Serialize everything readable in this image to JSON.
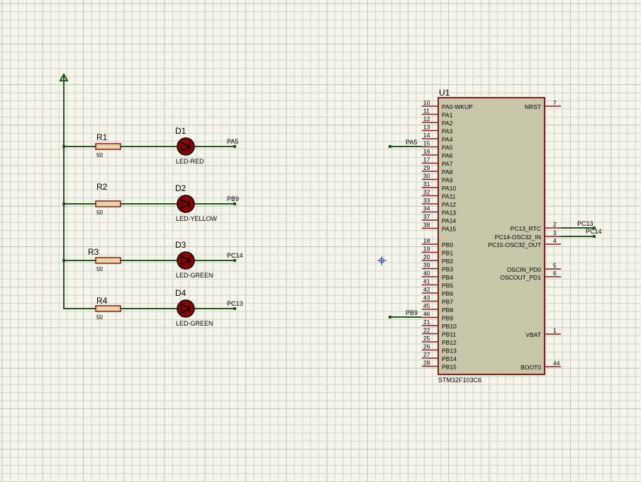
{
  "colors": {
    "background": "#f5f5eb",
    "grid_minor": "#d3d3c7",
    "grid_major": "#c2c2b3",
    "wire": "#1f5a1f",
    "component_outline": "#8b1a1a",
    "chip_fill": "#c6c6a8",
    "led_fill": "#8b0000",
    "resistor_fill": "#e8d6a8",
    "text": "#000000",
    "cursor": "#1f3fbf"
  },
  "power": {
    "symbol": "power-arrow-icon"
  },
  "resistors": [
    {
      "ref": "R1",
      "value": "50"
    },
    {
      "ref": "R2",
      "value": "50"
    },
    {
      "ref": "R3",
      "value": "50"
    },
    {
      "ref": "R4",
      "value": "50"
    }
  ],
  "leds": [
    {
      "ref": "D1",
      "type": "LED-RED",
      "net": "PA5"
    },
    {
      "ref": "D2",
      "type": "LED-YELLOW",
      "net": "PB9"
    },
    {
      "ref": "D3",
      "type": "LED-GREEN",
      "net": "PC14"
    },
    {
      "ref": "D4",
      "type": "LED-GREEN",
      "net": "PC13"
    }
  ],
  "chip": {
    "ref": "U1",
    "part": "STM32F103C6",
    "left_pins": [
      {
        "num": "10",
        "name": "PA0-WKUP"
      },
      {
        "num": "11",
        "name": "PA1"
      },
      {
        "num": "12",
        "name": "PA2"
      },
      {
        "num": "13",
        "name": "PA3"
      },
      {
        "num": "14",
        "name": "PA4"
      },
      {
        "num": "15",
        "name": "PA5"
      },
      {
        "num": "16",
        "name": "PA6"
      },
      {
        "num": "17",
        "name": "PA7"
      },
      {
        "num": "29",
        "name": "PA8"
      },
      {
        "num": "30",
        "name": "PA9"
      },
      {
        "num": "31",
        "name": "PA10"
      },
      {
        "num": "32",
        "name": "PA11"
      },
      {
        "num": "33",
        "name": "PA12"
      },
      {
        "num": "34",
        "name": "PA13"
      },
      {
        "num": "37",
        "name": "PA14"
      },
      {
        "num": "38",
        "name": "PA15"
      },
      {
        "num": "18",
        "name": "PB0"
      },
      {
        "num": "19",
        "name": "PB1"
      },
      {
        "num": "20",
        "name": "PB2"
      },
      {
        "num": "39",
        "name": "PB3"
      },
      {
        "num": "40",
        "name": "PB4"
      },
      {
        "num": "41",
        "name": "PB5"
      },
      {
        "num": "42",
        "name": "PB6"
      },
      {
        "num": "43",
        "name": "PB7"
      },
      {
        "num": "45",
        "name": "PB8"
      },
      {
        "num": "46",
        "name": "PB9"
      },
      {
        "num": "21",
        "name": "PB10"
      },
      {
        "num": "22",
        "name": "PB11"
      },
      {
        "num": "25",
        "name": "PB12"
      },
      {
        "num": "26",
        "name": "PB13"
      },
      {
        "num": "27",
        "name": "PB14"
      },
      {
        "num": "28",
        "name": "PB15"
      }
    ],
    "right_pins": [
      {
        "num": "7",
        "name": "NRST"
      },
      {
        "num": "2",
        "name": "PC13_RTC"
      },
      {
        "num": "3",
        "name": "PC14-OSC32_IN"
      },
      {
        "num": "4",
        "name": "PC15-OSC32_OUT"
      },
      {
        "num": "5",
        "name": "OSCIN_PD0"
      },
      {
        "num": "6",
        "name": "OSCOUT_PD1"
      },
      {
        "num": "1",
        "name": "VBAT"
      },
      {
        "num": "44",
        "name": "BOOT0"
      }
    ]
  },
  "chip_net_labels": {
    "pa5": "PA5",
    "pb9": "PB9",
    "pc13": "PC13",
    "pc14": "PC14"
  }
}
